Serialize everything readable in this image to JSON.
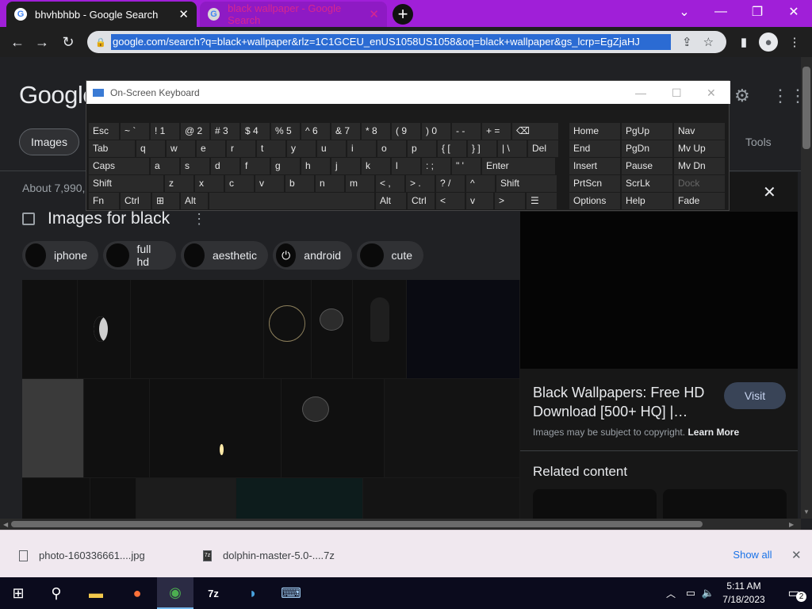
{
  "tabs": [
    {
      "title": "bhvhbhbb - Google Search",
      "active": true
    },
    {
      "title": "black wallpaper - Google Search",
      "active": false
    }
  ],
  "omnibox": {
    "url": "google.com/search?q=black+wallpaper&rlz=1C1GCEU_enUS1058US1058&oq=black+wallpaper&gs_lcrp=EgZjaHJ"
  },
  "google": {
    "logo": "Google",
    "images_tab": "Images",
    "tools": "Tools",
    "result_count": "About 7,990,",
    "images_heading": "Images for black",
    "chips": [
      "iphone",
      "full hd",
      "aesthetic",
      "android",
      "cute"
    ]
  },
  "panel": {
    "title": "Black Wallpapers: Free HD Download [500+ HQ] |…",
    "visit": "Visit",
    "copyright": "Images may be subject to copyright.",
    "learn_more": "Learn More",
    "related": "Related content"
  },
  "downloads": {
    "items": [
      "photo-160336661....jpg",
      "dolphin-master-5.0-....7z"
    ],
    "show_all": "Show all"
  },
  "taskbar": {
    "time": "5:11 AM",
    "date": "7/18/2023",
    "notifications": "2"
  },
  "osk": {
    "title": "On-Screen Keyboard",
    "rows": [
      [
        [
          "Esc",
          ""
        ],
        [
          "~ `",
          ""
        ],
        [
          "! 1",
          ""
        ],
        [
          "@ 2",
          ""
        ],
        [
          "# 3",
          ""
        ],
        [
          "$ 4",
          ""
        ],
        [
          "% 5",
          ""
        ],
        [
          "^ 6",
          ""
        ],
        [
          "& 7",
          ""
        ],
        [
          "* 8",
          ""
        ],
        [
          "( 9",
          ""
        ],
        [
          ") 0",
          ""
        ],
        [
          "- -",
          ""
        ],
        [
          "+ =",
          ""
        ],
        [
          "⌫",
          ""
        ],
        [
          "Home",
          ""
        ],
        [
          "PgUp",
          ""
        ],
        [
          "Nav",
          ""
        ]
      ],
      [
        [
          "Tab",
          ""
        ],
        [
          "q",
          ""
        ],
        [
          "w",
          ""
        ],
        [
          "e",
          ""
        ],
        [
          "r",
          ""
        ],
        [
          "t",
          ""
        ],
        [
          "y",
          ""
        ],
        [
          "u",
          ""
        ],
        [
          "i",
          ""
        ],
        [
          "o",
          ""
        ],
        [
          "p",
          ""
        ],
        [
          "{ [",
          ""
        ],
        [
          "} ]",
          ""
        ],
        [
          "| \\",
          ""
        ],
        [
          "Del",
          ""
        ],
        [
          "End",
          ""
        ],
        [
          "PgDn",
          ""
        ],
        [
          "Mv Up",
          ""
        ]
      ],
      [
        [
          "Caps",
          ""
        ],
        [
          "a",
          ""
        ],
        [
          "s",
          ""
        ],
        [
          "d",
          ""
        ],
        [
          "f",
          ""
        ],
        [
          "g",
          ""
        ],
        [
          "h",
          ""
        ],
        [
          "j",
          ""
        ],
        [
          "k",
          ""
        ],
        [
          "l",
          ""
        ],
        [
          ": ;",
          ""
        ],
        [
          "\" '",
          ""
        ],
        [
          "Enter",
          ""
        ],
        [
          "Insert",
          ""
        ],
        [
          "Pause",
          ""
        ],
        [
          "Mv Dn",
          ""
        ]
      ],
      [
        [
          "Shift",
          ""
        ],
        [
          "z",
          ""
        ],
        [
          "x",
          ""
        ],
        [
          "c",
          ""
        ],
        [
          "v",
          ""
        ],
        [
          "b",
          ""
        ],
        [
          "n",
          ""
        ],
        [
          "m",
          ""
        ],
        [
          "< ,",
          ""
        ],
        [
          "> .",
          ""
        ],
        [
          "? /",
          ""
        ],
        [
          "^",
          ""
        ],
        [
          "Shift",
          ""
        ],
        [
          "PrtScn",
          ""
        ],
        [
          "ScrLk",
          ""
        ],
        [
          "Dock",
          "dim"
        ]
      ],
      [
        [
          "Fn",
          ""
        ],
        [
          "Ctrl",
          ""
        ],
        [
          "⊞",
          ""
        ],
        [
          "Alt",
          ""
        ],
        [
          " ",
          ""
        ],
        [
          "Alt",
          ""
        ],
        [
          "Ctrl",
          ""
        ],
        [
          "<",
          ""
        ],
        [
          "v",
          ""
        ],
        [
          ">",
          ""
        ],
        [
          "☰",
          ""
        ],
        [
          "Options",
          ""
        ],
        [
          "Help",
          ""
        ],
        [
          "Fade",
          ""
        ]
      ]
    ]
  }
}
